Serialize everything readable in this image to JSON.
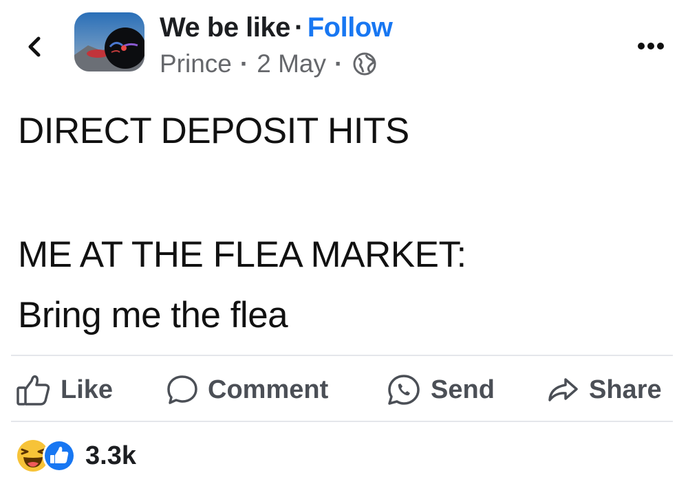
{
  "header": {
    "page_name": "We be like",
    "separator": "·",
    "follow_label": "Follow",
    "author": "Prince",
    "date": "2 May",
    "audience_icon": "globe-icon"
  },
  "post": {
    "line1": "DIRECT DEPOSIT HITS",
    "line2": "ME AT THE FLEA MARKET:",
    "line3": "Bring me the flea"
  },
  "actions": {
    "like": "Like",
    "comment": "Comment",
    "send": "Send",
    "share": "Share"
  },
  "reactions": {
    "icons": [
      "haha-icon",
      "like-icon"
    ],
    "count": "3.3k"
  },
  "colors": {
    "accent": "#1877f2",
    "muted": "#65676b",
    "divider": "#e4e6eb"
  }
}
